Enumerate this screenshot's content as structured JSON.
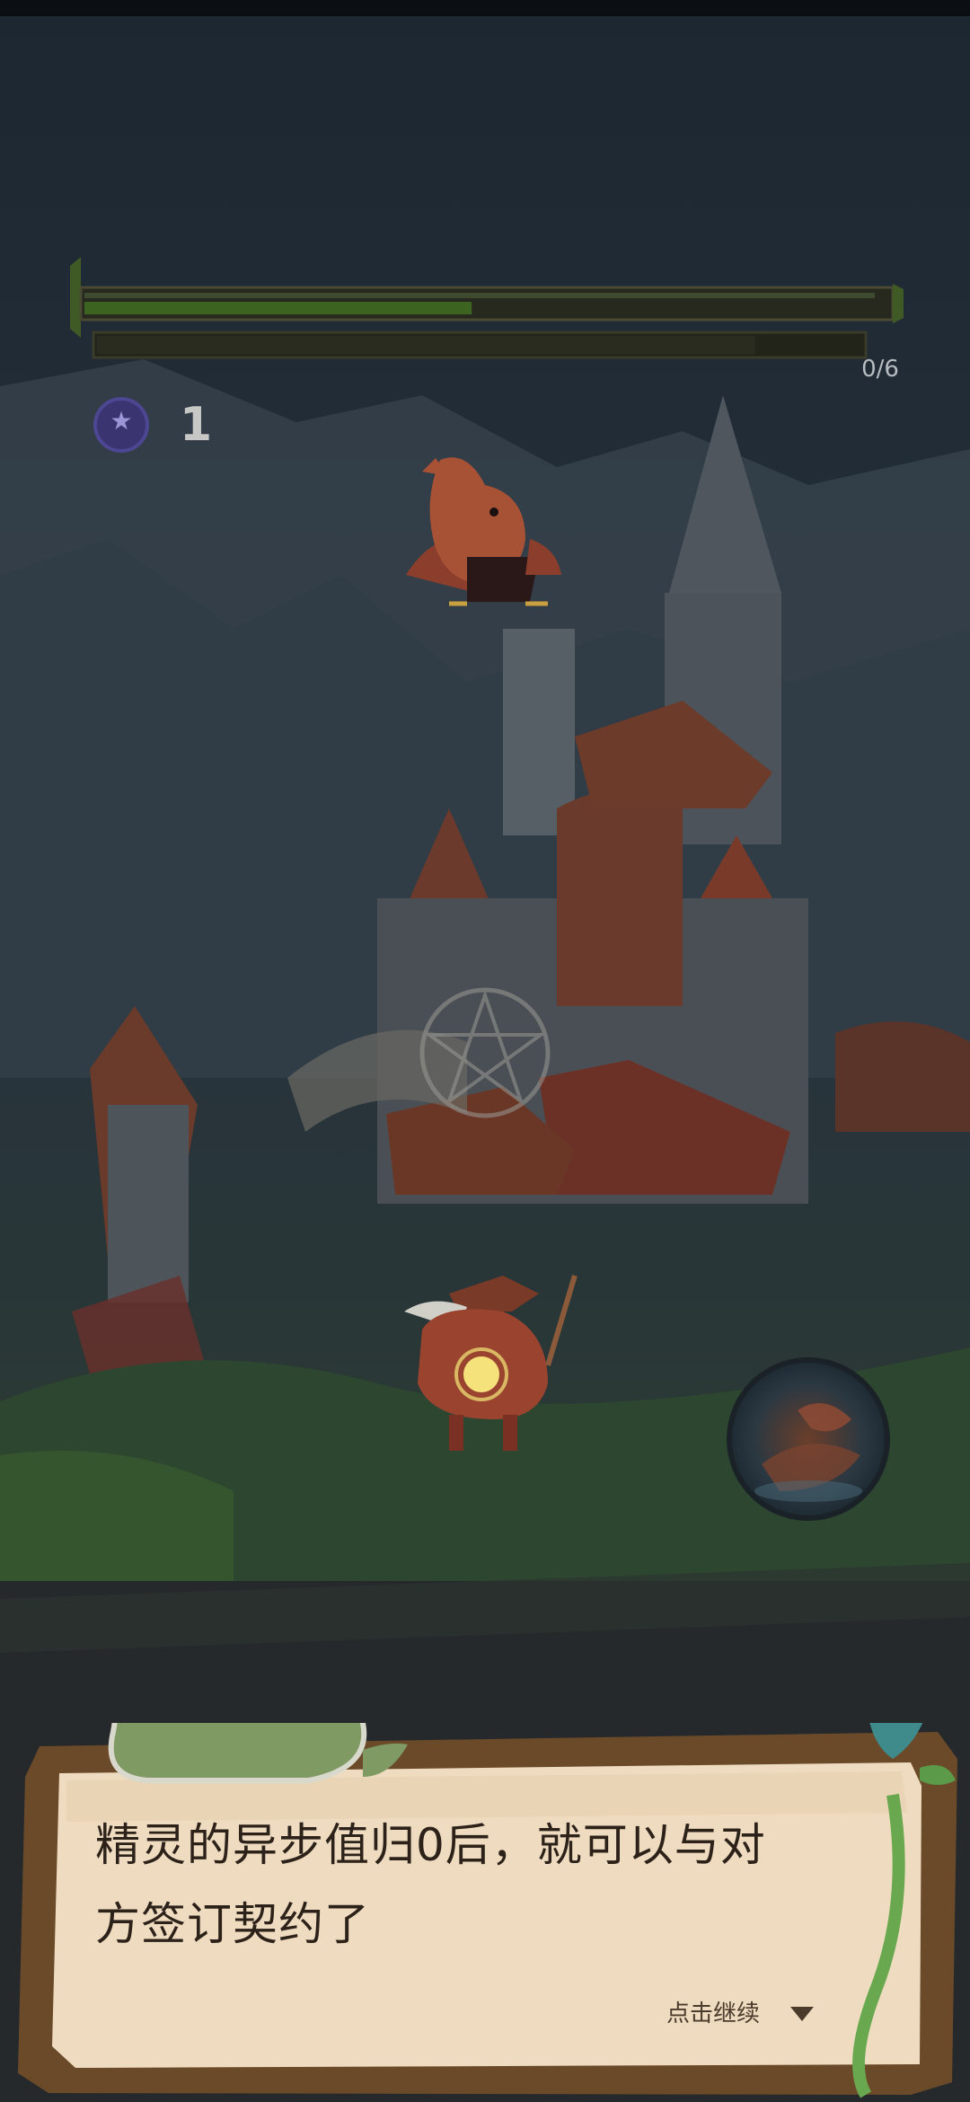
{
  "hud": {
    "progress_text": "0/6",
    "enemy_hp_fraction": 0.49,
    "enemy_secondary_fraction": 0.86,
    "coin_count": "1"
  },
  "icons": {
    "coin": "purple-star-coin-icon",
    "continue": "down-triangle-icon",
    "skill": "fire-spirit-orb-icon"
  },
  "dialog": {
    "text_line1": "精灵的异步值归0后，就可以与对",
    "text_line2": "方签订契约了",
    "continue_label": "点击继续"
  },
  "colors": {
    "hp_fill": "#3c6420",
    "parchment": "#efdcc0",
    "frame": "#6b4a2a"
  }
}
